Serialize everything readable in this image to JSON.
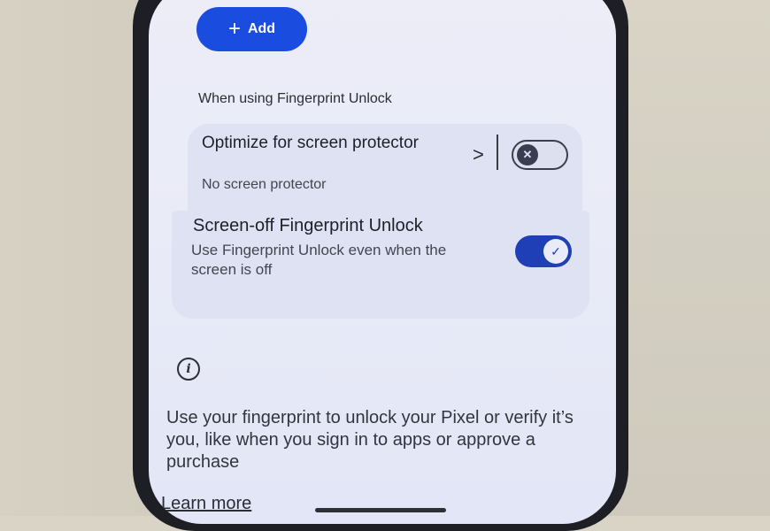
{
  "add_button": {
    "label": "Add",
    "icon": "plus-icon"
  },
  "section": {
    "label": "When using Fingerprint Unlock"
  },
  "screen_protector": {
    "title": "Optimize for screen protector",
    "subtitle": "No screen protector",
    "chevron": ">",
    "toggle_state": "off"
  },
  "screen_off": {
    "title": "Screen-off Fingerprint Unlock",
    "subtitle": "Use Fingerprint Unlock even when the screen is off",
    "toggle_state": "on"
  },
  "info": {
    "icon": "info-icon",
    "glyph": "i",
    "description": "Use your fingerprint to unlock your Pixel or verify it’s you, like when you sign in to apps or approve a purchase",
    "learn_more": "Learn more"
  },
  "colors": {
    "accent": "#1a4ce0",
    "toggle_on": "#1e3fb5",
    "card": "#dfe2f2",
    "screen": "#ecedf7"
  }
}
